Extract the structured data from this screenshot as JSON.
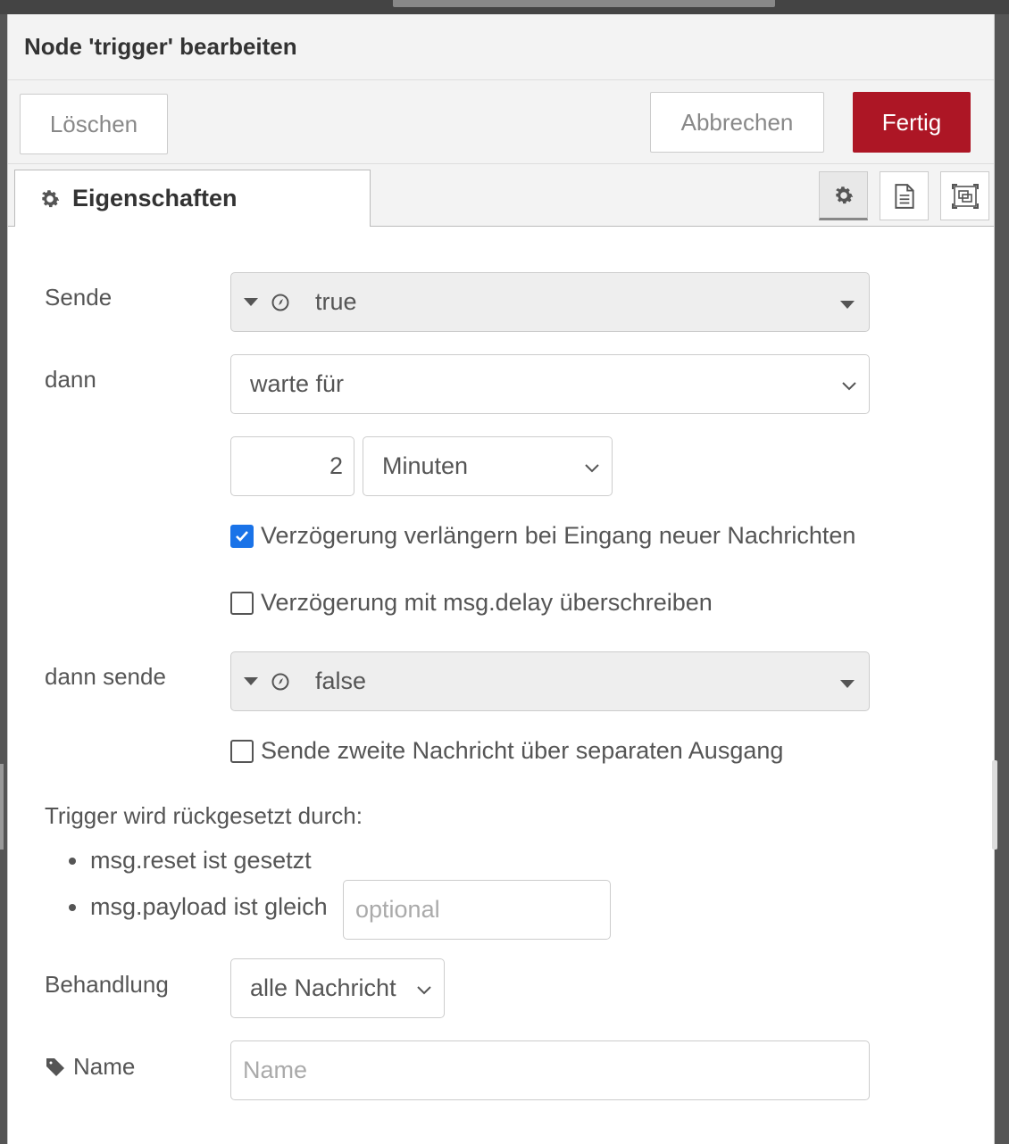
{
  "header": {
    "title": "Node 'trigger' bearbeiten"
  },
  "toolbar": {
    "delete_label": "Löschen",
    "cancel_label": "Abbrechen",
    "done_label": "Fertig"
  },
  "tabs": {
    "properties_label": "Eigenschaften",
    "icons": [
      "gear-icon",
      "document-icon",
      "frame-icon"
    ]
  },
  "form": {
    "send_label": "Sende",
    "send_value": "true",
    "then_label": "dann",
    "then_value": "warte für",
    "duration_value": "2",
    "duration_unit": "Minuten",
    "extend_delay_label": "Verzögerung verlängern bei Eingang neuer Nachrichten",
    "extend_delay_checked": true,
    "override_delay_label": "Verzögerung mit msg.delay überschreiben",
    "override_delay_checked": false,
    "then_send_label": "dann sende",
    "then_send_value": "false",
    "second_output_label": "Sende zweite Nachricht über separaten Ausgang",
    "second_output_checked": false,
    "reset_heading": "Trigger wird rückgesetzt durch:",
    "reset_item1": "msg.reset ist gesetzt",
    "reset_item2": "msg.payload ist gleich",
    "reset_placeholder": "optional",
    "handling_label": "Behandlung",
    "handling_value": "alle Nachricht",
    "name_label": "Name",
    "name_placeholder": "Name"
  },
  "colors": {
    "primary": "#ad1625",
    "checkbox": "#1a73e8"
  }
}
